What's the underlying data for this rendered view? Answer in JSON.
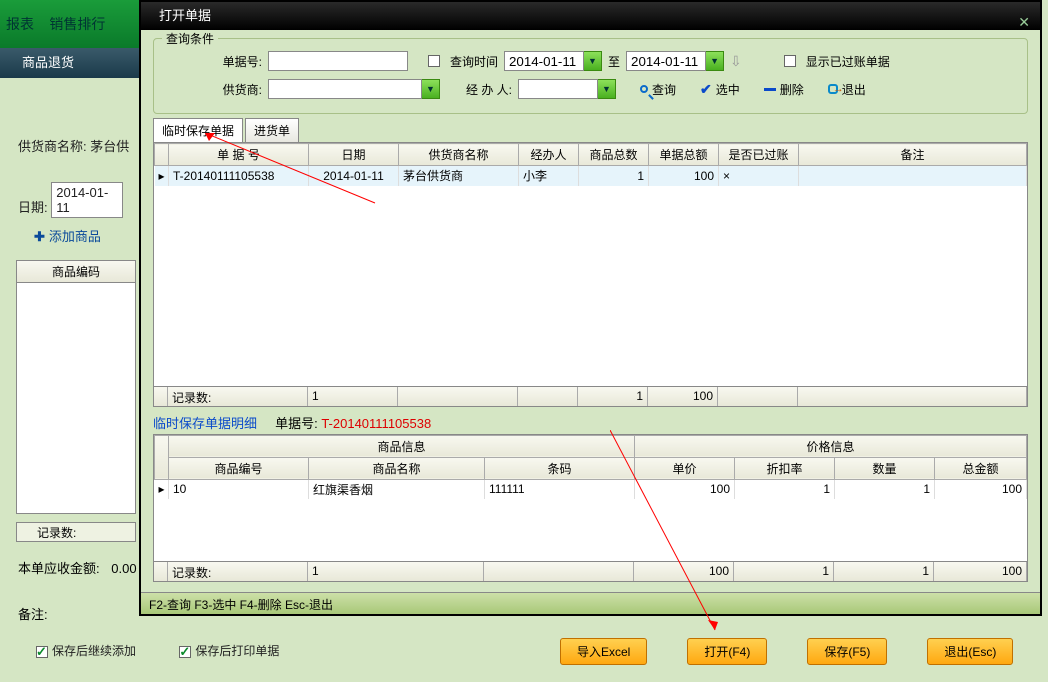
{
  "bg": {
    "top_btn1": "报表",
    "top_btn2": "销售排行",
    "menu_item": "商品退货",
    "supplier_label": "供货商名称:",
    "supplier_value": "茅台供",
    "date_label": "日期:",
    "date_value": "2014-01-11",
    "add_product": "添加商品",
    "product_code_header": "商品编码",
    "record_count": "记录数:",
    "total_label": "本单应收金额:",
    "total_value": "0.00",
    "remark_label": "备注:",
    "check1": "保存后继续添加",
    "check2": "保存后打印单据"
  },
  "dialog": {
    "title": "打开单据",
    "query": {
      "legend": "查询条件",
      "doc_no_label": "单据号:",
      "query_time_label": "查询时间",
      "date_from": "2014-01-11",
      "to_label": "至",
      "date_to": "2014-01-11",
      "show_posted_label": "显示已过账单据",
      "supplier_label": "供货商:",
      "handler_label": "经 办 人:",
      "btn_query": "查询",
      "btn_select": "选中",
      "btn_delete": "删除",
      "btn_exit": "退出"
    },
    "tabs": {
      "tab1": "临时保存单据",
      "tab2": "进货单"
    },
    "grid1": {
      "headers": [
        "单 据 号",
        "日期",
        "供货商名称",
        "经办人",
        "商品总数",
        "单据总额",
        "是否已过账",
        "备注"
      ],
      "row": {
        "doc_no": "T-20140111105538",
        "date": "2014-01-11",
        "supplier": "茅台供货商",
        "handler": "小李",
        "total_qty": "1",
        "total_amt": "100",
        "posted": "×",
        "remark": ""
      },
      "footer_label": "记录数:",
      "footer_count": "1",
      "footer_qty": "1",
      "footer_amt": "100"
    },
    "detail": {
      "title": "临时保存单据明细",
      "doc_label": "单据号:",
      "doc_no": "T-20140111105538"
    },
    "grid2": {
      "group1": "商品信息",
      "group2": "价格信息",
      "headers": [
        "商品编号",
        "商品名称",
        "条码",
        "单价",
        "折扣率",
        "数量",
        "总金额"
      ],
      "row": {
        "code": "10",
        "name": "红旗渠香烟",
        "barcode": "111111",
        "price": "100",
        "discount": "1",
        "qty": "1",
        "total": "100"
      },
      "footer_label": "记录数:",
      "footer_count": "1",
      "footer_price": "100",
      "footer_discount": "1",
      "footer_qty": "1",
      "footer_total": "100"
    },
    "statusbar": "F2-查询 F3-选中 F4-删除 Esc-退出"
  },
  "bottom": {
    "import": "导入Excel",
    "open": "打开(F4)",
    "save": "保存(F5)",
    "exit": "退出(Esc)"
  }
}
